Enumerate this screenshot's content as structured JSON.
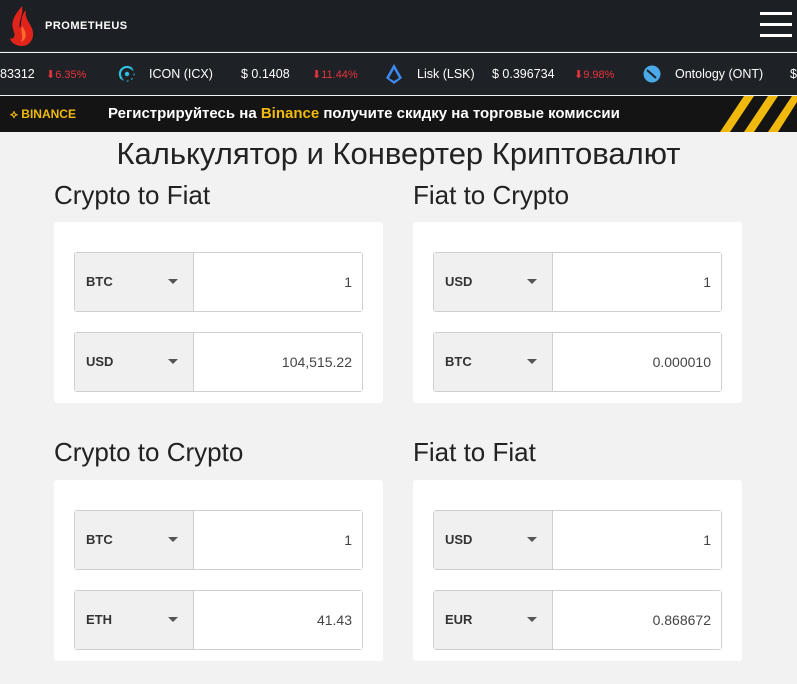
{
  "header": {
    "brand": "PROMETHEUS",
    "logo_icon": "flame-icon",
    "menu_icon": "hamburger-menu-icon"
  },
  "ticker": {
    "items": [
      {
        "text": "83312",
        "change": "6.35%",
        "direction": "down"
      },
      {
        "icon": "icon-coin-icon",
        "name": "ICON (ICX)",
        "price": "$ 0.1408",
        "change": "11.44%",
        "direction": "down"
      },
      {
        "icon": "lisk-coin-icon",
        "name": "Lisk (LSK)",
        "price": "$ 0.396734",
        "change": "9.98%",
        "direction": "down"
      },
      {
        "icon": "ontology-coin-icon",
        "name": "Ontology (ONT)",
        "price": "$"
      }
    ]
  },
  "banner": {
    "logo": "BINANCE",
    "text_before": "Регистрируйтесь на ",
    "highlight": "Binance",
    "text_after": " получите скидку на торговые комиссии"
  },
  "page_title": "Калькулятор и Конвертер Криптовалют",
  "converters": [
    {
      "title": "Crypto to Fiat",
      "from": {
        "currency": "BTC",
        "value": "1"
      },
      "to": {
        "currency": "USD",
        "value": "104,515.22"
      }
    },
    {
      "title": "Fiat to Crypto",
      "from": {
        "currency": "USD",
        "value": "1"
      },
      "to": {
        "currency": "BTC",
        "value": "0.000010"
      }
    },
    {
      "title": "Crypto to Crypto",
      "from": {
        "currency": "BTC",
        "value": "1"
      },
      "to": {
        "currency": "ETH",
        "value": "41.43"
      }
    },
    {
      "title": "Fiat to Fiat",
      "from": {
        "currency": "USD",
        "value": "1"
      },
      "to": {
        "currency": "EUR",
        "value": "0.868672"
      }
    }
  ],
  "colors": {
    "ticker_down": "#e8343b",
    "binance_yellow": "#f0b90b",
    "header_bg": "#1c1f23"
  }
}
